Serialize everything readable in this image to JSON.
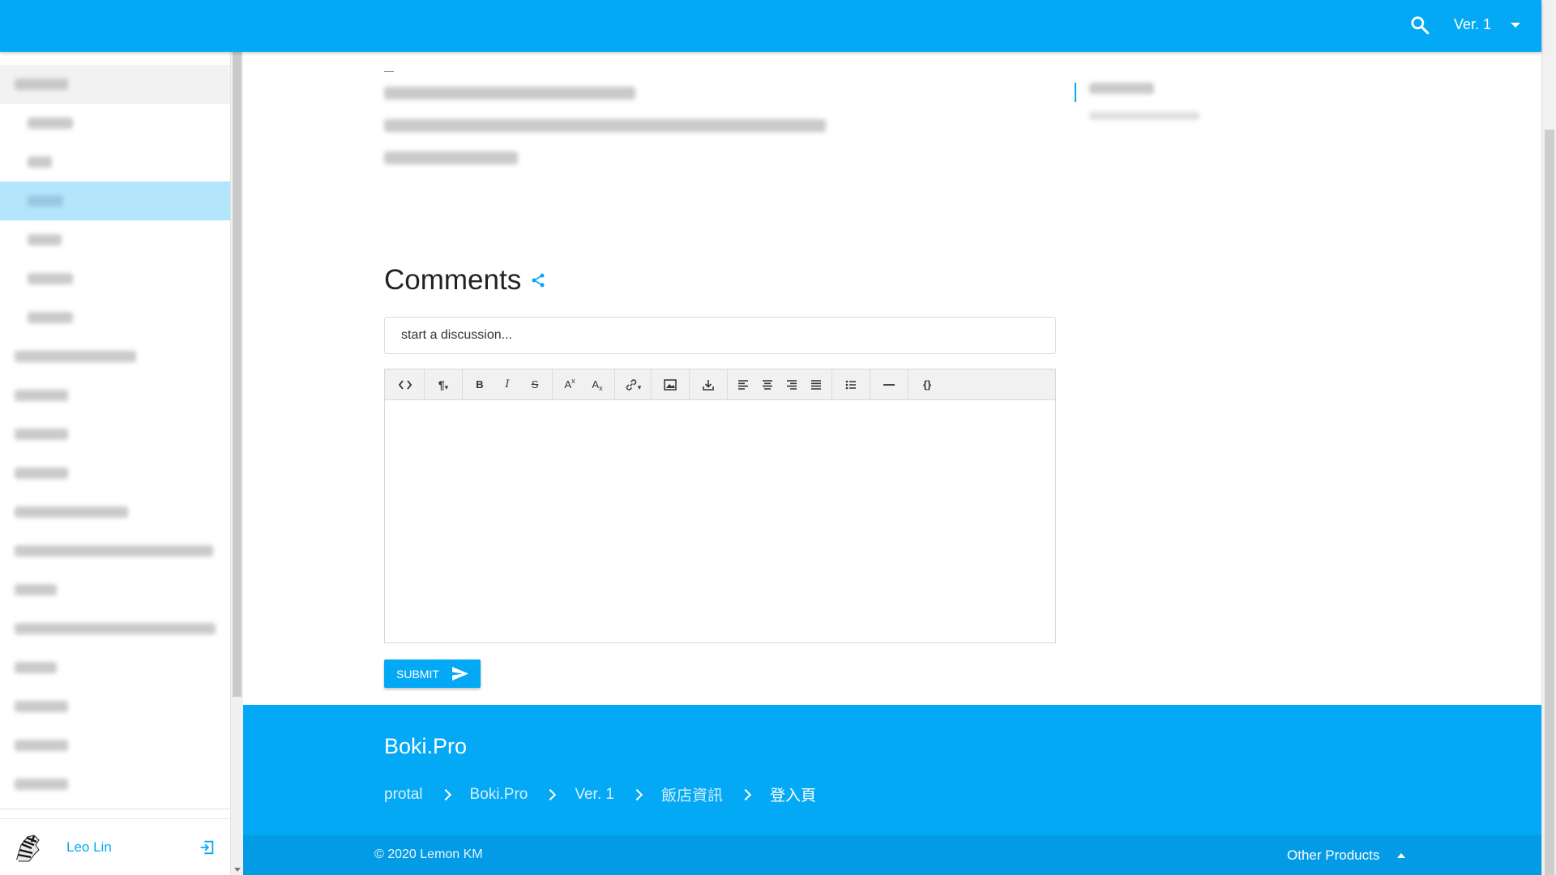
{
  "header": {
    "version_label": "Ver. 1",
    "search_icon": "search-icon",
    "caret_icon": "caret-down-icon"
  },
  "sidebar": {
    "user_name": "Leo Lin",
    "avatar_icon": "zebra-avatar",
    "logout_icon": "logout-icon"
  },
  "comments": {
    "title": "Comments",
    "share_icon": "share-icon",
    "input_placeholder": "start a discussion...",
    "submit_label": "SUBMIT",
    "toolbar": [
      {
        "name": "code-view-button",
        "glyph": "<>"
      },
      {
        "name": "paragraph-format-button",
        "glyph": "¶"
      },
      {
        "name": "bold-button",
        "glyph": "B"
      },
      {
        "name": "italic-button",
        "glyph": "I"
      },
      {
        "name": "strikethrough-button",
        "glyph": "S"
      },
      {
        "name": "superscript-button",
        "glyph": "A"
      },
      {
        "name": "subscript-button",
        "glyph": "A"
      },
      {
        "name": "insert-link-button",
        "glyph": "link"
      },
      {
        "name": "insert-image-button",
        "glyph": "image"
      },
      {
        "name": "insert-file-button",
        "glyph": "download"
      },
      {
        "name": "align-left-button",
        "glyph": "align-left"
      },
      {
        "name": "align-center-button",
        "glyph": "align-center"
      },
      {
        "name": "align-right-button",
        "glyph": "align-right"
      },
      {
        "name": "align-justify-button",
        "glyph": "align-justify"
      },
      {
        "name": "bullet-list-button",
        "glyph": "list"
      },
      {
        "name": "horizontal-rule-button",
        "glyph": "—"
      },
      {
        "name": "code-block-button",
        "glyph": "{}"
      }
    ]
  },
  "footer": {
    "brand": "Boki.Pro",
    "breadcrumb": [
      "protal",
      "Boki.Pro",
      "Ver. 1",
      "飯店資訊",
      "登入頁"
    ],
    "copyright": "© 2020 Lemon KM",
    "other_products": "Other Products"
  },
  "colors": {
    "accent": "#03a9f4",
    "active_nav": "#b3e5fc"
  }
}
